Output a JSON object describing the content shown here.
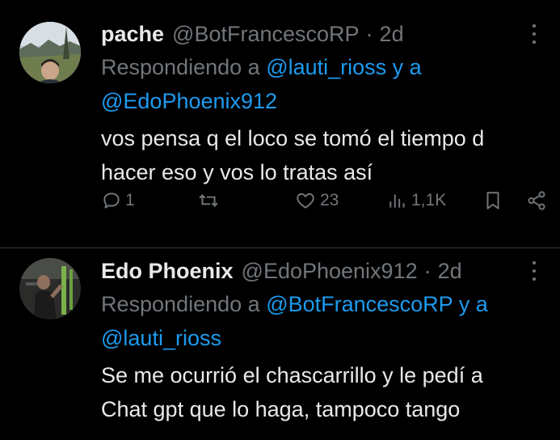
{
  "tweets": [
    {
      "name": "pache",
      "handle": "@BotFrancescoRP",
      "time": "2d",
      "reply_prefix": "Respondiendo a",
      "mentions": [
        "@lauti_rioss",
        "@EdoPhoenix912"
      ],
      "joiner": "y a",
      "text_lines": [
        "vos pensa q el loco se tomó el tiempo d",
        "hacer eso y vos lo tratas así"
      ],
      "actions": {
        "replies": "1",
        "reposts": "",
        "likes": "23",
        "views": "1,1K"
      }
    },
    {
      "name": "Edo Phoenix",
      "handle": "@EdoPhoenix912",
      "time": "2d",
      "reply_prefix": "Respondiendo a",
      "mentions": [
        "@BotFrancescoRP",
        "@lauti_rioss"
      ],
      "joiner": "y a",
      "text_lines": [
        "Se me ocurrió el chascarrillo y le pedí a",
        "Chat gpt que lo haga, tampoco tango"
      ]
    }
  ],
  "separator": "·",
  "colors": {
    "background": "#000000",
    "text": "#e7e9ea",
    "muted": "#71767b",
    "link": "#1d9bf0"
  }
}
